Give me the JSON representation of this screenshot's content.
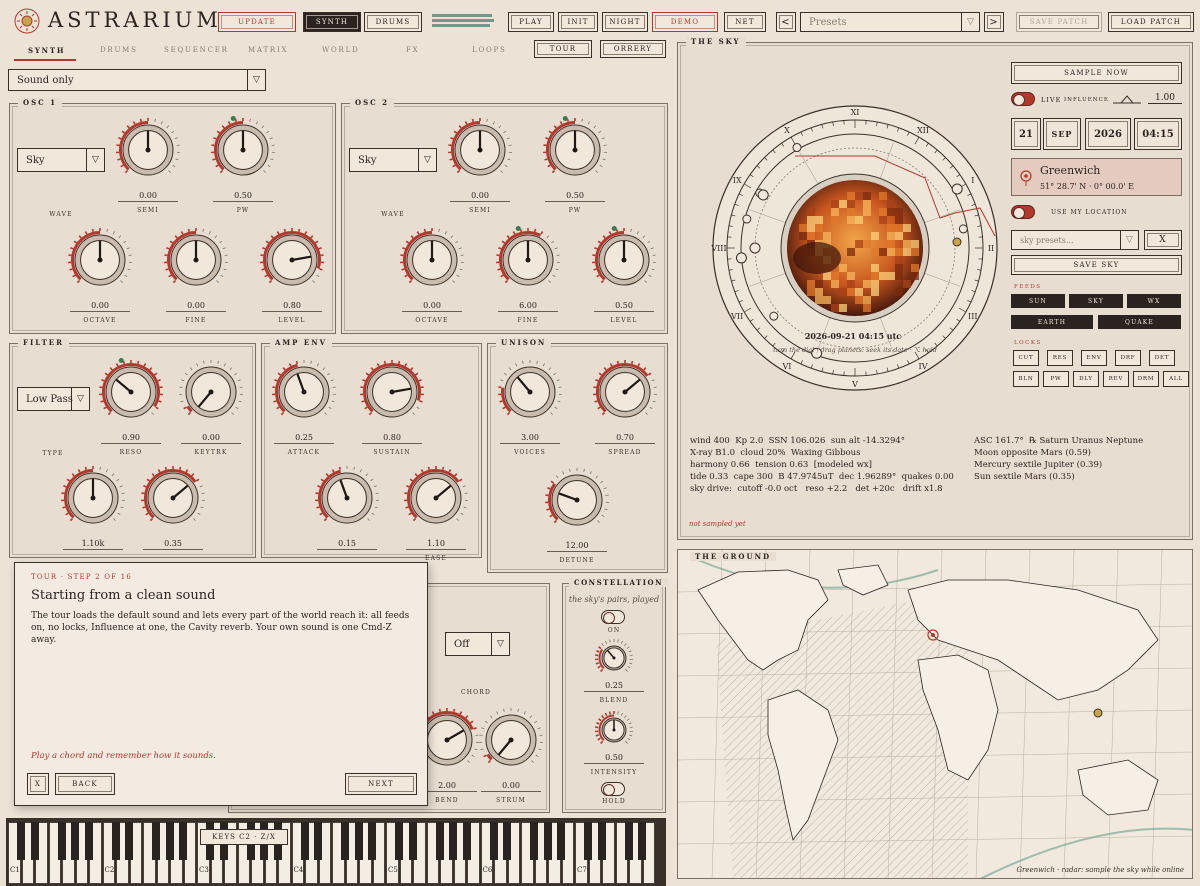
{
  "app": {
    "title": "ASTRARIUM",
    "logo": "sun-logo-icon"
  },
  "header": {
    "update": "UPDATE",
    "synth": "SYNTH",
    "drums": "DRUMS",
    "play": "PLAY",
    "init": "INIT",
    "night": "NIGHT",
    "demo": "DEMO",
    "net": "NET",
    "presets_placeholder": "Presets",
    "save_patch": "SAVE PATCH",
    "load_patch": "LOAD PATCH",
    "prev": "<",
    "next": ">"
  },
  "tabs": [
    "SYNTH",
    "DRUMS",
    "SEQUENCER",
    "MATRIX",
    "WORLD",
    "FX",
    "LOOPS"
  ],
  "tour_btn": "TOUR",
  "orrery_btn": "ORRERY",
  "sound_select": "Sound only",
  "osc1": {
    "title": "OSC 1",
    "wave": "Sky",
    "wave_label": "WAVE",
    "semi": "0.00",
    "semi_label": "SEMI",
    "pw": "0.50",
    "pw_label": "PW",
    "octave": "0.00",
    "octave_label": "OCTAVE",
    "fine": "0.00",
    "fine_label": "FINE",
    "level": "0.80",
    "level_label": "LEVEL"
  },
  "osc2": {
    "title": "OSC 2",
    "wave": "Sky",
    "wave_label": "WAVE",
    "semi": "0.00",
    "semi_label": "SEMI",
    "pw": "0.50",
    "pw_label": "PW",
    "octave": "0.00",
    "octave_label": "OCTAVE",
    "fine": "6.00",
    "fine_label": "FINE",
    "level": "0.50",
    "level_label": "LEVEL"
  },
  "filter": {
    "title": "FILTER",
    "type": "Low Pass",
    "type_label": "TYPE",
    "reso": "0.90",
    "reso_label": "RESO",
    "keytrk": "0.00",
    "keytrk_label": "KEYTRK",
    "cutoff": "1.10k",
    "env": "0.35"
  },
  "ampenv": {
    "title": "AMP ENV",
    "attack": "0.25",
    "attack_label": "ATTACK",
    "sustain": "0.80",
    "sustain_label": "SUSTAIN",
    "decay": "0.15",
    "release": "1.10",
    "release_label": "EASE"
  },
  "unison": {
    "title": "UNISON",
    "voices": "3.00",
    "voices_label": "VOICES",
    "spread": "0.70",
    "spread_label": "SPREAD",
    "detune": "12.00",
    "detune_label": "DETUNE"
  },
  "chord": {
    "select": "Off",
    "label": "CHORD",
    "bend": "2.00",
    "bend_label": "BEND",
    "strum": "0.00",
    "strum_label": "STRUM"
  },
  "constellation": {
    "title": "CONSTELLATION",
    "subtitle": "the sky's pairs, played",
    "on_label": "ON",
    "blend": "0.25",
    "blend_label": "BLEND",
    "intensity": "0.50",
    "intensity_label": "INTENSITY",
    "hold_label": "HOLD"
  },
  "tour": {
    "step": "TOUR · STEP 2 OF 16",
    "title": "Starting from a clean sound",
    "body": "The tour loads the default sound and lets every part of the world reach it: all feeds on, no locks, Influence at one, the Cavity reverb. Your own sound is one Cmd-Z away.",
    "hint": "Play a chord and remember how it sounds.",
    "close": "X",
    "back": "BACK",
    "next": "NEXT"
  },
  "sky": {
    "title": "THE SKY",
    "sample_now": "SAMPLE NOW",
    "live": "LIVE",
    "influence": "INFLUENCE",
    "influence_val": "1.00",
    "day": "21",
    "month": "SEP",
    "year": "2026",
    "time": "04:15",
    "location_name": "Greenwich",
    "location_coords": "51° 28.7' N · 0° 00.0' E",
    "use_location": "USE MY LOCATION",
    "sky_presets": "sky presets...",
    "close": "X",
    "save_sky": "SAVE SKY",
    "feeds_label": "FEEDS",
    "feeds": [
      "SUN",
      "SKY",
      "WX",
      "EARTH",
      "QUAKE"
    ],
    "locks_label": "LOCKS",
    "locks": [
      "CUT",
      "RES",
      "ENV",
      "DRF",
      "DET",
      "BLN",
      "PW",
      "DLY",
      "REV",
      "DRM",
      "ALL"
    ],
    "datetime": "2026-09-21 04:15 utc",
    "hint": "turn the dial · drag planets: seek its date · ⌥ hold",
    "numerals": [
      "X",
      "XI",
      "XII",
      "I",
      "II",
      "III",
      "IV",
      "V",
      "VI",
      "VII",
      "VIII",
      "IX"
    ],
    "stats_left": [
      "wind 400  Kp 2.0  SSN 106.026  sun alt -14.3294°",
      "X-ray B1.0  cloud 20%  Waxing Gibbous",
      "harmony 0.66  tension 0.63  [modeled wx]",
      "tide 0.33  cape 300  B 47.9745uT  dec 1.96289°  quakes 0.00",
      "sky drive:  cutoff -0.0 oct   reso +2.2   det +20c   drift x1.8"
    ],
    "stats_right": [
      "ASC 161.7°  ℞ Saturn Uranus Neptune",
      "Moon opposite Mars (0.59)",
      "Mercury sextile Jupiter (0.39)",
      "Sun sextile Mars (0.35)"
    ],
    "not_sampled": "not sampled yet"
  },
  "ground": {
    "title": "THE GROUND",
    "caption": "Greenwich · radar: sample the sky while online"
  },
  "keys": {
    "label": "KEYS C2 · Z/X",
    "octaves": [
      "C1",
      "C2",
      "C3",
      "C4",
      "C5",
      "C6",
      "C7"
    ]
  },
  "colors": {
    "accent": "#b2392e",
    "dark": "#2b2320",
    "paper": "#ece2d6"
  }
}
